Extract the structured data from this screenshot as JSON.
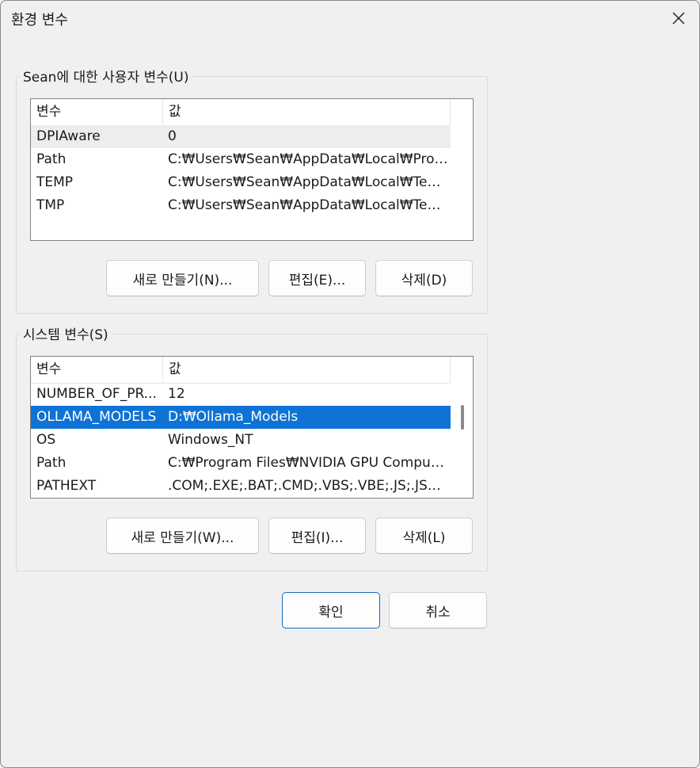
{
  "window": {
    "title": "환경 변수"
  },
  "user_vars": {
    "group_label": "Sean에 대한 사용자 변수(U)",
    "columns": [
      "변수",
      "값"
    ],
    "rows": [
      {
        "name": "DPIAware",
        "value": "0"
      },
      {
        "name": "Path",
        "value": "C:₩Users₩Sean₩AppData₩Local₩Progra..."
      },
      {
        "name": "TEMP",
        "value": "C:₩Users₩Sean₩AppData₩Local₩Temp"
      },
      {
        "name": "TMP",
        "value": "C:₩Users₩Sean₩AppData₩Local₩Temp"
      }
    ],
    "buttons": {
      "new": "새로 만들기(N)...",
      "edit": "편집(E)...",
      "delete": "삭제(D)"
    }
  },
  "system_vars": {
    "group_label": "시스템 변수(S)",
    "columns": [
      "변수",
      "값"
    ],
    "rows": [
      {
        "name": "NUMBER_OF_PR...",
        "value": "12"
      },
      {
        "name": "OLLAMA_MODELS",
        "value": "D:₩Ollama_Models"
      },
      {
        "name": "OS",
        "value": "Windows_NT"
      },
      {
        "name": "Path",
        "value": "C:₩Program Files₩NVIDIA GPU Computin..."
      },
      {
        "name": "PATHEXT",
        "value": ".COM;.EXE;.BAT;.CMD;.VBS;.VBE;.JS;.JSE;.W..."
      }
    ],
    "selected_row": "OLLAMA_MODELS",
    "buttons": {
      "new": "새로 만들기(W)...",
      "edit": "편집(I)...",
      "delete": "삭제(L)"
    }
  },
  "footer": {
    "ok": "확인",
    "cancel": "취소"
  },
  "colors": {
    "selection": "#0f73d6",
    "hover_row": "#ededed",
    "background": "#f0f0f0"
  },
  "icons": {
    "close": "close-icon"
  }
}
